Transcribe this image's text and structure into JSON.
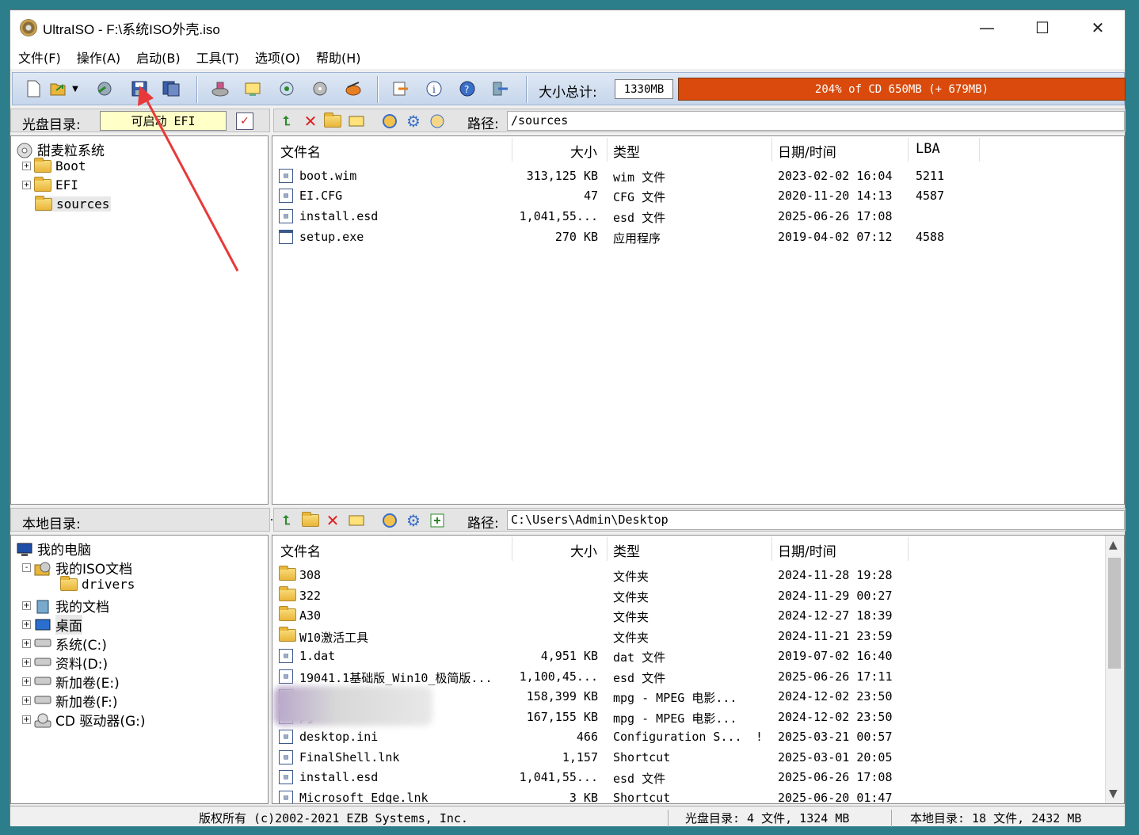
{
  "window": {
    "title": "UltraISO - F:\\系统ISO外壳.iso",
    "minimize": "—",
    "maximize": "☐",
    "close": "✕"
  },
  "menu": [
    "文件(F)",
    "操作(A)",
    "启动(B)",
    "工具(T)",
    "选项(O)",
    "帮助(H)"
  ],
  "toolbar": {
    "size_label": "大小总计:",
    "size_value": "1330MB",
    "capacity_text": "204% of CD 650MB (+ 679MB)"
  },
  "iso_pane": {
    "label": "光盘目录:",
    "boot_type": "可启动 EFI",
    "path_label": "路径:",
    "path_value": "/sources",
    "tree": [
      {
        "label": "甜麦粒系统",
        "icon": "cd-icon",
        "expander": ""
      },
      {
        "label": "Boot",
        "icon": "folder-icon",
        "expander": "+"
      },
      {
        "label": "EFI",
        "icon": "folder-icon",
        "expander": "+"
      },
      {
        "label": "sources",
        "icon": "folder-icon",
        "expander": ""
      }
    ],
    "columns": [
      "文件名",
      "大小",
      "类型",
      "日期/时间",
      "LBA"
    ],
    "files": [
      {
        "name": "boot.wim",
        "size": "313,125 KB",
        "type": "wim 文件",
        "date": "2023-02-02 16:04",
        "lba": "5211"
      },
      {
        "name": "EI.CFG",
        "size": "47",
        "type": "CFG 文件",
        "date": "2020-11-20 14:13",
        "lba": "4587"
      },
      {
        "name": "install.esd",
        "size": "1,041,55...",
        "type": "esd 文件",
        "date": "2025-06-26 17:08",
        "lba": ""
      },
      {
        "name": "setup.exe",
        "size": "270 KB",
        "type": "应用程序",
        "date": "2019-04-02 07:12",
        "lba": "4588"
      }
    ]
  },
  "local_pane": {
    "label": "本地目录:",
    "path_label": "路径:",
    "path_value": "C:\\Users\\Admin\\Desktop",
    "tree": [
      {
        "label": "我的电脑",
        "icon": "computer-icon",
        "expander": ""
      },
      {
        "label": "我的ISO文档",
        "icon": "iso-folder-icon",
        "expander": "-"
      },
      {
        "label": "drivers",
        "icon": "folder-icon",
        "expander": ""
      },
      {
        "label": "我的文档",
        "icon": "documents-icon",
        "expander": "+"
      },
      {
        "label": "桌面",
        "icon": "desktop-icon",
        "expander": "+"
      },
      {
        "label": "系统(C:)",
        "icon": "drive-icon",
        "expander": "+"
      },
      {
        "label": "资料(D:)",
        "icon": "drive-icon",
        "expander": "+"
      },
      {
        "label": "新加卷(E:)",
        "icon": "drive-icon",
        "expander": "+"
      },
      {
        "label": "新加卷(F:)",
        "icon": "drive-icon",
        "expander": "+"
      },
      {
        "label": "CD 驱动器(G:)",
        "icon": "cd-drive-icon",
        "expander": "+"
      }
    ],
    "columns": [
      "文件名",
      "大小",
      "类型",
      "日期/时间"
    ],
    "files": [
      {
        "name": "308",
        "size": "",
        "type": "文件夹",
        "date": "2024-11-28 19:28",
        "folder": true
      },
      {
        "name": "322",
        "size": "",
        "type": "文件夹",
        "date": "2024-11-29 00:27",
        "folder": true
      },
      {
        "name": "A30",
        "size": "",
        "type": "文件夹",
        "date": "2024-12-27 18:39",
        "folder": true
      },
      {
        "name": "W10激活工具",
        "size": "",
        "type": "文件夹",
        "date": "2024-11-21 23:59",
        "folder": true
      },
      {
        "name": "1.dat",
        "size": "4,951 KB",
        "type": "dat 文件",
        "date": "2019-07-02 16:40",
        "folder": false
      },
      {
        "name": "19041.1基础版_Win10_极简版...",
        "size": "1,100,45...",
        "type": "esd 文件",
        "date": "2025-06-26 17:11",
        "folder": false
      },
      {
        "name": "",
        "size": "158,399 KB",
        "type": "mpg - MPEG 电影...",
        "date": "2024-12-02 23:50",
        "folder": false
      },
      {
        "name": "pg",
        "size": "167,155 KB",
        "type": "mpg - MPEG 电影...",
        "date": "2024-12-02 23:50",
        "folder": false
      },
      {
        "name": "desktop.ini",
        "size": "466",
        "type": "Configuration S...",
        "date": "2025-03-21 00:57",
        "folder": false,
        "flag": "!"
      },
      {
        "name": "FinalShell.lnk",
        "size": "1,157",
        "type": "Shortcut",
        "date": "2025-03-01 20:05",
        "folder": false
      },
      {
        "name": "install.esd",
        "size": "1,041,55...",
        "type": "esd 文件",
        "date": "2025-06-26 17:08",
        "folder": false
      },
      {
        "name": "Microsoft Edge.lnk",
        "size": "3 KB",
        "type": "Shortcut",
        "date": "2025-06-20 01:47",
        "folder": false
      }
    ]
  },
  "status": {
    "copyright": "版权所有 (c)2002-2021 EZB Systems, Inc.",
    "iso_summary": "光盘目录: 4 文件, 1324 MB",
    "local_summary": "本地目录: 18 文件, 2432 MB"
  },
  "colors": {
    "capacity_bar": "#d94a0c",
    "annotation_arrow": "#e8393a"
  }
}
